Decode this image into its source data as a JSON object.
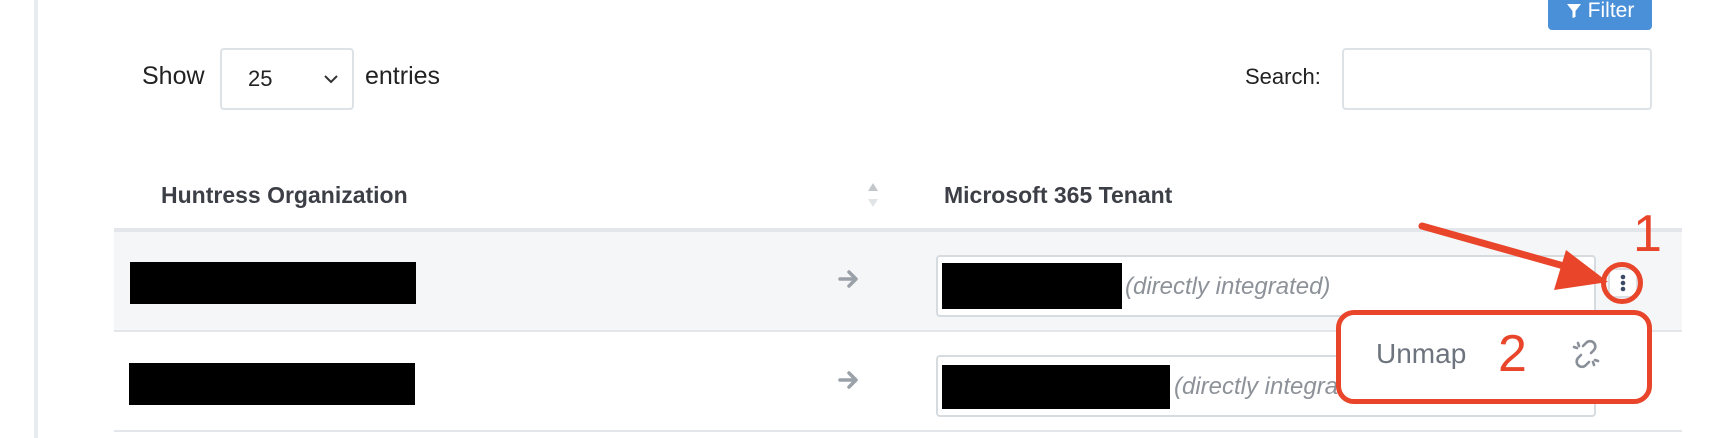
{
  "toolbar": {
    "filter_label": "Filter"
  },
  "length_control": {
    "show_label": "Show",
    "selected": "25",
    "entries_label": "entries"
  },
  "search": {
    "label": "Search:",
    "value": ""
  },
  "table": {
    "columns": [
      "Huntress Organization",
      "Microsoft 365 Tenant"
    ],
    "rows": [
      {
        "tenant_note": "(directly integrated)"
      },
      {
        "tenant_note": "(directly integrated)"
      }
    ]
  },
  "dropdown": {
    "unmap_label": "Unmap"
  },
  "annotations": {
    "step1": "1",
    "step2": "2",
    "color": "#e8452b"
  },
  "colors": {
    "filter_button": "#4a90d9",
    "annotation": "#e8452b"
  }
}
